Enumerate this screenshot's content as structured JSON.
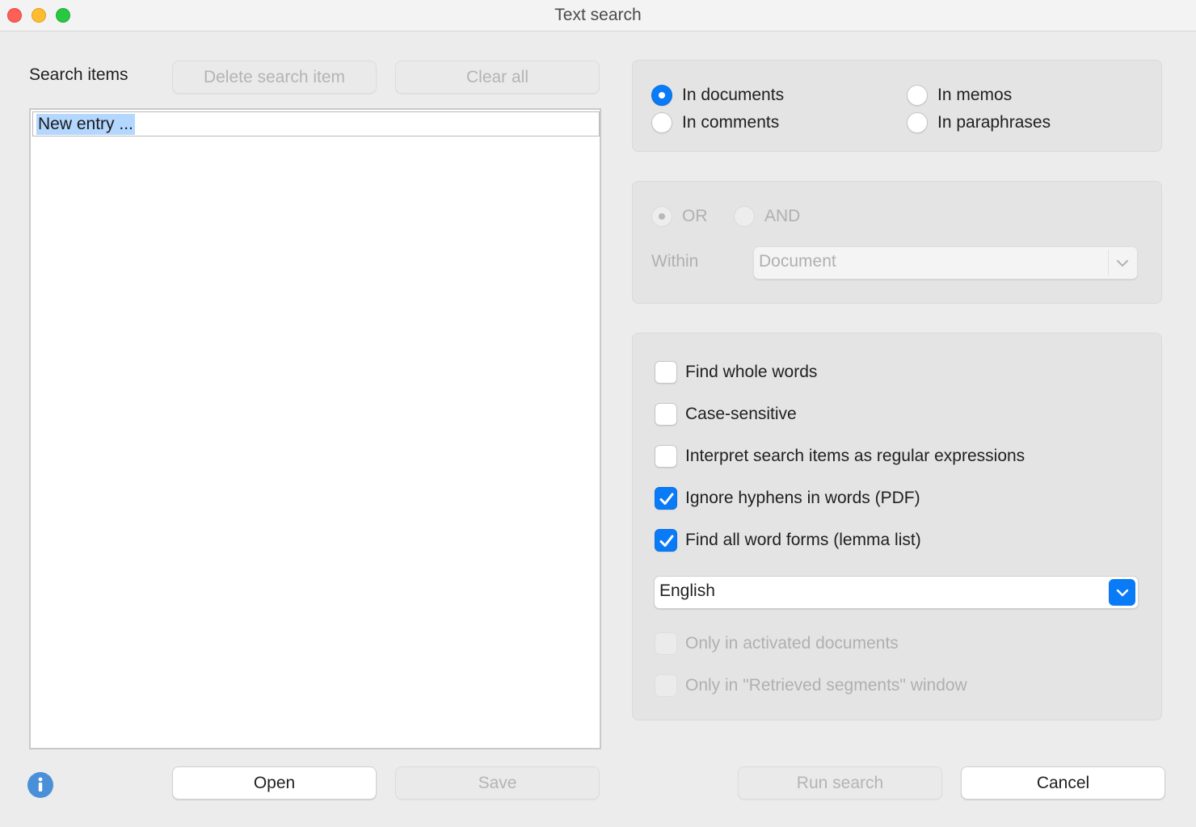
{
  "window": {
    "title": "Text search"
  },
  "search_items": {
    "label": "Search items",
    "delete_button": "Delete search item",
    "clear_button": "Clear all",
    "entries": [
      "New entry ..."
    ],
    "open_button": "Open",
    "save_button": "Save"
  },
  "scope": {
    "in_documents": {
      "label": "In documents",
      "selected": true
    },
    "in_memos": {
      "label": "In memos",
      "selected": false
    },
    "in_comments": {
      "label": "In comments",
      "selected": false
    },
    "in_paraphrases": {
      "label": "In paraphrases",
      "selected": false
    }
  },
  "logic": {
    "or": {
      "label": "OR",
      "selected": true,
      "enabled": false
    },
    "and": {
      "label": "AND",
      "selected": false,
      "enabled": false
    },
    "within_label": "Within",
    "within_value": "Document"
  },
  "options": {
    "whole_words": {
      "label": "Find whole words",
      "checked": false
    },
    "case_sensitive": {
      "label": "Case-sensitive",
      "checked": false
    },
    "regex": {
      "label": "Interpret search items as regular expressions",
      "checked": false
    },
    "ignore_hyphens": {
      "label": "Ignore hyphens in words (PDF)",
      "checked": true
    },
    "word_forms": {
      "label": "Find all word forms (lemma list)",
      "checked": true
    },
    "language": "English",
    "activated_docs": {
      "label": "Only in activated documents",
      "checked": false,
      "enabled": false
    },
    "retrieved_segments": {
      "label": "Only in \"Retrieved segments\" window",
      "checked": false,
      "enabled": false
    }
  },
  "footer": {
    "run_button": "Run search",
    "cancel_button": "Cancel"
  },
  "colors": {
    "accent": "#0a7bf7",
    "selection": "#b3d7ff",
    "info": "#4a90d9"
  }
}
